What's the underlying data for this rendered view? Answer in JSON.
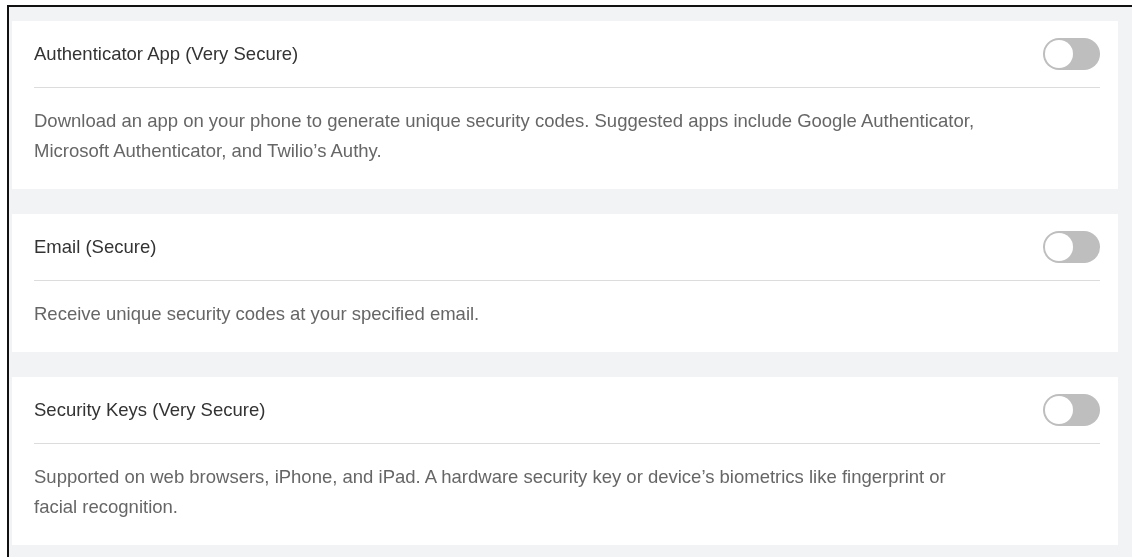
{
  "methods": [
    {
      "title": "Authenticator App (Very Secure)",
      "on": false,
      "description": "Download an app on your phone to generate unique security codes. Suggested apps include Google Authenticator, Microsoft Authenticator, and Twilio’s Authy."
    },
    {
      "title": "Email (Secure)",
      "on": false,
      "description": "Receive unique security codes at your specified email."
    },
    {
      "title": "Security Keys (Very Secure)",
      "on": false,
      "description": "Supported on web browsers, iPhone, and iPad. A hardware security key or device’s biometrics like fingerprint or facial recognition."
    }
  ]
}
